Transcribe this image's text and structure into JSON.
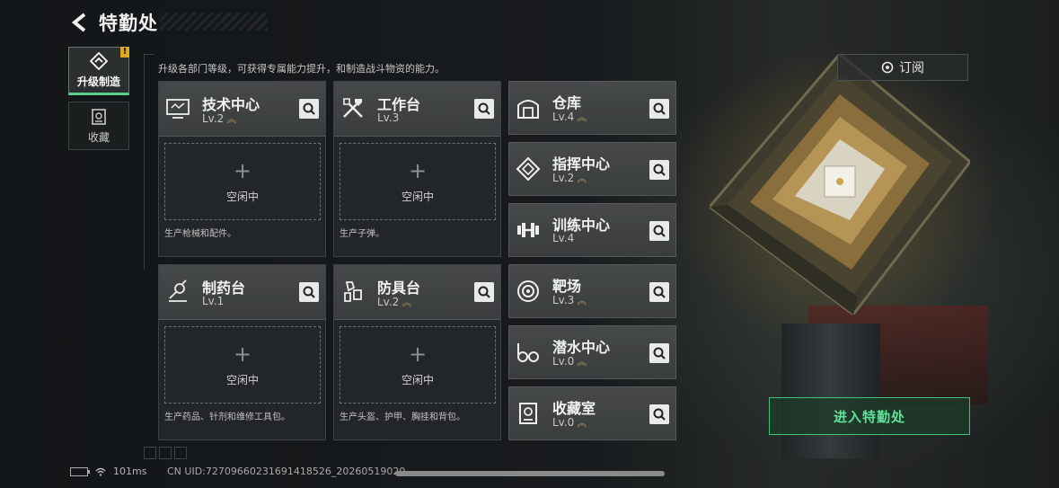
{
  "header": {
    "title": "特勤处",
    "subscribe_label": "订阅"
  },
  "sidebar": {
    "items": [
      {
        "label": "升级制造",
        "icon": "upgrade-icon",
        "active": true,
        "alert": "!"
      },
      {
        "label": "收藏",
        "icon": "collection-icon",
        "active": false
      }
    ]
  },
  "description": "升级各部门等级，可获得专属能力提升，和制造战斗物资的能力。",
  "workshops": [
    {
      "name": "技术中心",
      "level": "Lv.2",
      "slot_plus": "+",
      "slot_text": "空闲中",
      "note": "生产枪械和配件。",
      "icon": "tech-center-icon"
    },
    {
      "name": "工作台",
      "level": "Lv.3",
      "slot_plus": "+",
      "slot_text": "空闲中",
      "note": "生产子弹。",
      "icon": "workbench-icon"
    },
    {
      "name": "制药台",
      "level": "Lv.1",
      "slot_plus": "+",
      "slot_text": "空闲中",
      "note": "生产药品、针剂和维修工具包。",
      "icon": "pharmacy-icon"
    },
    {
      "name": "防具台",
      "level": "Lv.2",
      "slot_plus": "+",
      "slot_text": "空闲中",
      "note": "生产头盔、护甲、胸挂和背包。",
      "icon": "armor-bench-icon"
    }
  ],
  "facilities": [
    {
      "name": "仓库",
      "level": "Lv.4",
      "icon": "warehouse-icon"
    },
    {
      "name": "指挥中心",
      "level": "Lv.2",
      "icon": "command-center-icon"
    },
    {
      "name": "训练中心",
      "level": "Lv.4",
      "icon": "training-center-icon"
    },
    {
      "name": "靶场",
      "level": "Lv.3",
      "icon": "shooting-range-icon"
    },
    {
      "name": "潜水中心",
      "level": "Lv.0",
      "icon": "diving-center-icon"
    },
    {
      "name": "收藏室",
      "level": "Lv.0",
      "icon": "collection-room-icon"
    }
  ],
  "enter_button": "进入特勤处",
  "footer": {
    "ping": "101ms",
    "uid": "CN UID:7270966023169141852​6_20260519020"
  },
  "colors": {
    "accent_green": "#5ee398",
    "panel": "#3a3d3e",
    "alert": "#e0a81d"
  }
}
